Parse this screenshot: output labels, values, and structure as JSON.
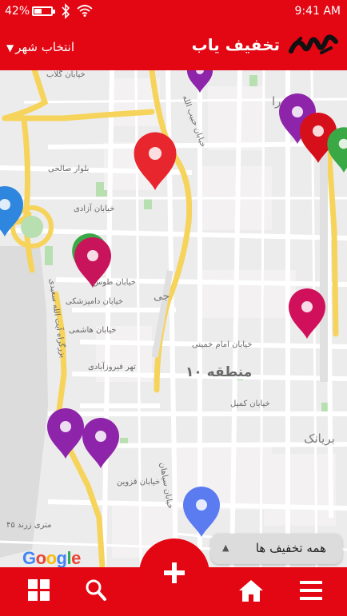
{
  "status_bar": {
    "battery_percent": "42%",
    "time": "9:41 AM",
    "icons": [
      "battery-icon",
      "bluetooth-icon",
      "wifi-icon"
    ]
  },
  "header": {
    "title": "تخفیف یاب",
    "city_selector": "انتخاب شهر",
    "logo_icon": "brand-logo-icon"
  },
  "map": {
    "street_labels": [
      "خیابان گلاب",
      "بلوار صالحی",
      "خیابان آزادی",
      "خیابان طوس",
      "خیابان دامپزشکی",
      "خیابان هاشمی",
      "خیابان امام خمینی",
      "تهر فیروزآبادی",
      "خیابان کمیل",
      "خیابان قزوین",
      "خیابان سپاهان",
      "۴۵ متری زرند",
      "بزرگراه آیت الله سعیدی",
      "خیابان حبیب الله"
    ],
    "district_label": "منطقه ۱۰",
    "area_labels": [
      "بریانک",
      "را",
      "جی"
    ],
    "attribution": "Google",
    "pins": [
      {
        "color": "#e8262e",
        "name": "discount-pin"
      },
      {
        "color": "#2e86de",
        "name": "discount-pin"
      },
      {
        "color": "#3aa845",
        "name": "discount-pin"
      },
      {
        "color": "#c8145a",
        "name": "discount-pin"
      },
      {
        "color": "#8e24aa",
        "name": "discount-pin"
      },
      {
        "color": "#d0105a",
        "name": "discount-pin"
      },
      {
        "color": "#8e24aa",
        "name": "discount-pin"
      },
      {
        "color": "#8e24aa",
        "name": "discount-pin"
      },
      {
        "color": "#5b7cf0",
        "name": "discount-pin"
      },
      {
        "color": "#8e24aa",
        "name": "discount-pin"
      },
      {
        "color": "#d6101a",
        "name": "discount-pin"
      },
      {
        "color": "#3aa845",
        "name": "discount-pin"
      }
    ]
  },
  "all_discounts_button": {
    "label": "همه تخفیف ها",
    "icon": "caret-up-icon"
  },
  "bottom_nav": {
    "icons": [
      "grid-icon",
      "search-icon",
      "add-icon",
      "home-icon",
      "menu-icon"
    ]
  },
  "colors": {
    "brand_red": "#e30613",
    "map_background": "#ececec",
    "main_road": "#f6d35a"
  }
}
